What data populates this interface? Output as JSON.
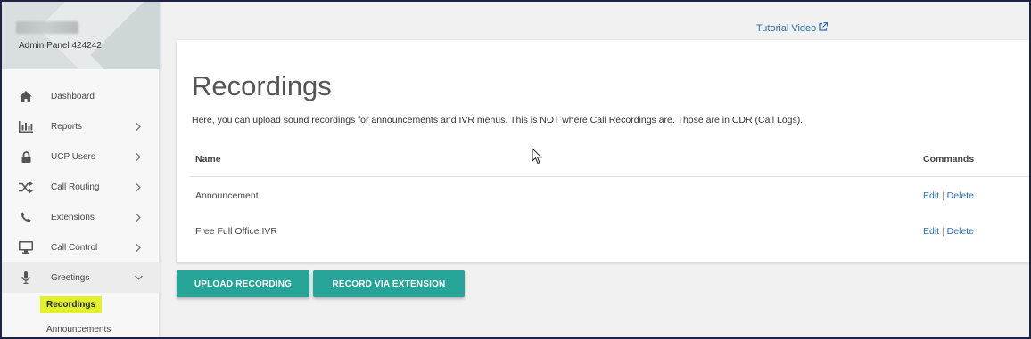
{
  "sidebar": {
    "admin_label": "Admin Panel 424242",
    "items": [
      {
        "label": "Dashboard",
        "icon": "home-icon",
        "chevron": "none"
      },
      {
        "label": "Reports",
        "icon": "bar-chart-icon",
        "chevron": "right"
      },
      {
        "label": "UCP Users",
        "icon": "lock-icon",
        "chevron": "right"
      },
      {
        "label": "Call Routing",
        "icon": "shuffle-icon",
        "chevron": "right"
      },
      {
        "label": "Extensions",
        "icon": "phone-icon",
        "chevron": "right"
      },
      {
        "label": "Call Control",
        "icon": "monitor-icon",
        "chevron": "right"
      },
      {
        "label": "Greetings",
        "icon": "microphone-icon",
        "chevron": "down"
      }
    ],
    "sub_items": [
      {
        "label": "Recordings",
        "active": true
      },
      {
        "label": "Announcements",
        "active": false
      }
    ]
  },
  "header": {
    "tutorial_link": "Tutorial Video"
  },
  "main": {
    "title": "Recordings",
    "description": "Here, you can upload sound recordings for announcements and IVR menus. This is NOT where Call Recordings are. Those are in CDR (Call Logs).",
    "columns": [
      "Name",
      "Commands"
    ],
    "rows": [
      {
        "name": "Announcement",
        "edit": "Edit",
        "separator": "|",
        "delete": "Delete"
      },
      {
        "name": "Free Full Office IVR",
        "edit": "Edit",
        "separator": "|",
        "delete": "Delete"
      }
    ],
    "buttons": {
      "upload": "UPLOAD RECORDING",
      "record": "RECORD VIA EXTENSION"
    }
  },
  "colors": {
    "accent": "#26a497",
    "link": "#2a6fb0",
    "highlight": "#e3f12a",
    "frame": "#1f2447"
  }
}
